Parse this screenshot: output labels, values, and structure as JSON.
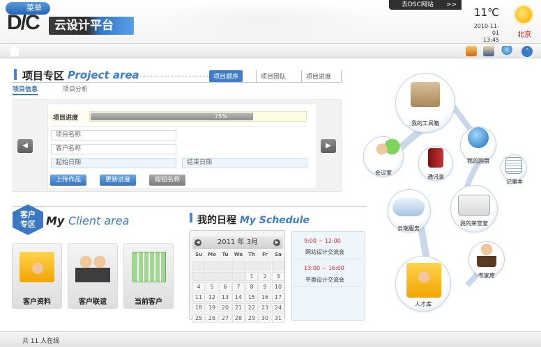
{
  "header": {
    "logo": "D/C",
    "brand": "云设计平台",
    "visit_link": "去DSC网站",
    "temperature": "11℃",
    "date": "2010-11-01",
    "time": "13:45",
    "city": "北京"
  },
  "menu": {
    "label": "菜单"
  },
  "project": {
    "title": "项目专区",
    "title_en": "Project area",
    "tabs": [
      "项目顺序",
      "项目团队",
      "项目进度"
    ],
    "subtabs": [
      "项目信息",
      "项目分析"
    ],
    "progress_label": "项目进度",
    "progress_value": 0.75,
    "progress_text": "75%",
    "fields": [
      "项目名称",
      "客户名称",
      "起始日期",
      "结束日期"
    ],
    "buttons": [
      "上传作品",
      "更新进度",
      "按钮名称"
    ]
  },
  "client": {
    "badge_line1": "客户",
    "badge_line2": "专区",
    "title_my": "My",
    "title_rest": "Client area",
    "tiles": [
      "客户资料",
      "客户联谊",
      "当前客户"
    ]
  },
  "schedule": {
    "title": "我的日程",
    "title_en": "My Schedule",
    "calendar_header": "2011 年  3月",
    "dow": [
      "Su",
      "Mo",
      "Tu",
      "We",
      "Th",
      "Fr",
      "Sa"
    ],
    "days": [
      "",
      "",
      "",
      "",
      "",
      "",
      "",
      "",
      "",
      "",
      "",
      "1",
      "2",
      "3",
      "4",
      "5",
      "6",
      "7",
      "8",
      "9",
      "10",
      "11",
      "12",
      "13",
      "14",
      "15",
      "16",
      "17",
      "18",
      "19",
      "20",
      "21",
      "22",
      "23",
      "24",
      "25",
      "26",
      "27",
      "28",
      "29",
      "30",
      "31"
    ],
    "events": [
      {
        "time": "9:00 ~ 12:00",
        "name": "网站设计交流会"
      },
      {
        "time": "13:00 ~ 16:00",
        "name": "平面设计交流会"
      }
    ]
  },
  "bubbles": [
    "我的工具箱",
    "会议室",
    "通讯录",
    "我的网盘",
    "记事本",
    "云端服务",
    "我的荣誉室",
    "专家库",
    "人才库"
  ],
  "footer": {
    "online": "共 11 人在线"
  },
  "colors": {
    "accent": "#3b7dd0",
    "dark": "#2e2e2e",
    "event_time": "#dd2222"
  }
}
